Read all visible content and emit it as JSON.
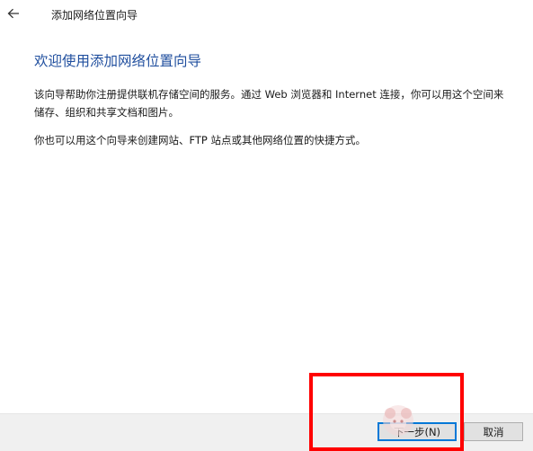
{
  "titlebar": {
    "back_icon": "back-arrow-icon",
    "title": "添加网络位置向导"
  },
  "main": {
    "heading": "欢迎使用添加网络位置向导",
    "paragraph1": "该向导帮助你注册提供联机存储空间的服务。通过 Web 浏览器和 Internet 连接，你可以用这个空间来储存、组织和共享文档和图片。",
    "paragraph2": "你也可以用这个向导来创建网站、FTP 站点或其他网络位置的快捷方式。"
  },
  "footer": {
    "next_label": "下一步(N)",
    "cancel_label": "取消"
  },
  "colors": {
    "heading": "#1f4e9e",
    "highlight": "#ff0000",
    "footer_bg": "#f0f0f0",
    "button_bg": "#e1e1e1",
    "focus_border": "#0078d7"
  }
}
